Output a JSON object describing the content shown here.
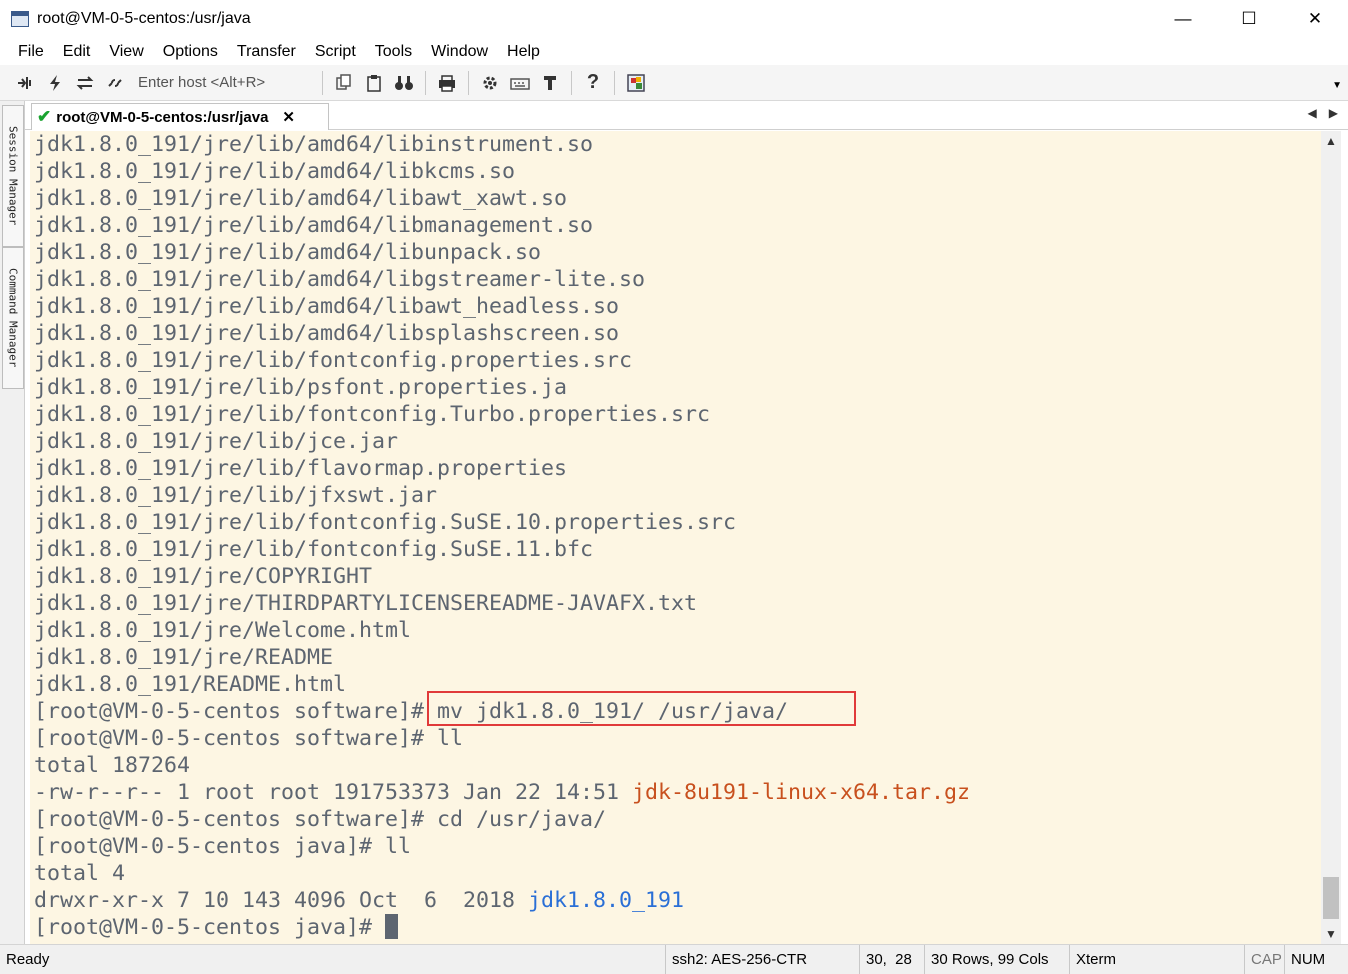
{
  "window": {
    "title": "root@VM-0-5-centos:/usr/java",
    "controls": [
      "—",
      "☐",
      "✕"
    ]
  },
  "menu": [
    "File",
    "Edit",
    "View",
    "Options",
    "Transfer",
    "Script",
    "Tools",
    "Window",
    "Help"
  ],
  "toolbar": {
    "host_placeholder": "Enter host <Alt+R>",
    "icons": [
      "connect-icon",
      "quick-connect-icon",
      "reconnect-icon",
      "disconnect-icon",
      "copy-icon",
      "paste-icon",
      "find-icon",
      "print-icon",
      "settings-icon",
      "keymap-icon",
      "sftp-icon",
      "help-icon",
      "screenshot-icon"
    ]
  },
  "side_panel": {
    "session_manager": "Session Manager",
    "command_manager": "Command Manager"
  },
  "tab": {
    "label": "root@VM-0-5-centos:/usr/java",
    "close": "✕"
  },
  "terminal": {
    "lines": [
      "jdk1.8.0_191/jre/lib/amd64/libinstrument.so",
      "jdk1.8.0_191/jre/lib/amd64/libkcms.so",
      "jdk1.8.0_191/jre/lib/amd64/libawt_xawt.so",
      "jdk1.8.0_191/jre/lib/amd64/libmanagement.so",
      "jdk1.8.0_191/jre/lib/amd64/libunpack.so",
      "jdk1.8.0_191/jre/lib/amd64/libgstreamer-lite.so",
      "jdk1.8.0_191/jre/lib/amd64/libawt_headless.so",
      "jdk1.8.0_191/jre/lib/amd64/libsplashscreen.so",
      "jdk1.8.0_191/jre/lib/fontconfig.properties.src",
      "jdk1.8.0_191/jre/lib/psfont.properties.ja",
      "jdk1.8.0_191/jre/lib/fontconfig.Turbo.properties.src",
      "jdk1.8.0_191/jre/lib/jce.jar",
      "jdk1.8.0_191/jre/lib/flavormap.properties",
      "jdk1.8.0_191/jre/lib/jfxswt.jar",
      "jdk1.8.0_191/jre/lib/fontconfig.SuSE.10.properties.src",
      "jdk1.8.0_191/jre/lib/fontconfig.SuSE.11.bfc",
      "jdk1.8.0_191/jre/COPYRIGHT",
      "jdk1.8.0_191/jre/THIRDPARTYLICENSEREADME-JAVAFX.txt",
      "jdk1.8.0_191/jre/Welcome.html",
      "jdk1.8.0_191/jre/README",
      "jdk1.8.0_191/README.html",
      "[root@VM-0-5-centos software]# mv jdk1.8.0_191/ /usr/java/",
      "[root@VM-0-5-centos software]# ll",
      "total 187264"
    ],
    "ls_row1_prefix": "-rw-r--r-- 1 root root 191753373 Jan 22 14:51 ",
    "ls_row1_file": "jdk-8u191-linux-x64.tar.gz",
    "line_cd": "[root@VM-0-5-centos software]# cd /usr/java/",
    "line_ll": "[root@VM-0-5-centos java]# ll",
    "line_total": "total 4",
    "ls_row2_prefix": "drwxr-xr-x 7 10 143 4096 Oct  6  2018 ",
    "ls_row2_dir": "jdk1.8.0_191",
    "prompt": "[root@VM-0-5-centos java]# ",
    "colors": {
      "background": "#fdf6e3",
      "text": "#5d6570",
      "archive": "#c8501e",
      "directory": "#2a6fd6",
      "highlight_box": "#e03a3a"
    }
  },
  "status": {
    "ready": "Ready",
    "cipher": "ssh2: AES-256-CTR",
    "position": "30,  28",
    "size": "30 Rows, 99 Cols",
    "emulation": "Xterm",
    "cap": "CAP",
    "num": "NUM"
  }
}
